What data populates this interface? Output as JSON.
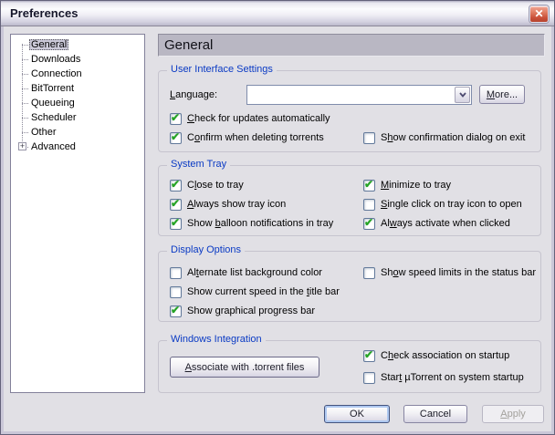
{
  "window": {
    "title": "Preferences"
  },
  "icons": {
    "close": "✕",
    "check": "✔",
    "plus": "+",
    "chevron": "chevron-down"
  },
  "colors": {
    "accent_blue": "#0a3ac4",
    "check_green": "#27a427",
    "close_red": "#c84e38",
    "titlebar_silver": "#d3d1e0"
  },
  "sidebar": {
    "items": [
      {
        "label": "General",
        "selected": true
      },
      {
        "label": "Downloads"
      },
      {
        "label": "Connection"
      },
      {
        "label": "BitTorrent"
      },
      {
        "label": "Queueing"
      },
      {
        "label": "Scheduler"
      },
      {
        "label": "Other"
      },
      {
        "label": "Advanced",
        "expandable": true
      }
    ]
  },
  "header": {
    "title": "General"
  },
  "ui_group": {
    "caption": "User Interface Settings",
    "language": {
      "label": "Language:",
      "mnemonic": 0,
      "value": ""
    },
    "more_button": {
      "label": "More...",
      "mnemonic": 0
    },
    "checks": [
      {
        "label": "Check for updates automatically",
        "mnemonic": 0,
        "checked": true
      },
      {
        "label": "Confirm when deleting torrents",
        "mnemonic": 1,
        "checked": true
      },
      {
        "label": "Show confirmation dialog on exit",
        "mnemonic": 1,
        "checked": false
      }
    ]
  },
  "tray_group": {
    "caption": "System Tray",
    "left": [
      {
        "label": "Close to tray",
        "mnemonic": 1,
        "checked": true
      },
      {
        "label": "Always show tray icon",
        "mnemonic": 0,
        "checked": true
      },
      {
        "label": "Show balloon notifications in tray",
        "mnemonic": 5,
        "checked": true
      }
    ],
    "right": [
      {
        "label": "Minimize to tray",
        "mnemonic": 0,
        "checked": true
      },
      {
        "label": "Single click on tray icon to open",
        "mnemonic": 0,
        "checked": false
      },
      {
        "label": "Always activate when clicked",
        "mnemonic": 2,
        "checked": true
      }
    ]
  },
  "display_group": {
    "caption": "Display Options",
    "left": [
      {
        "label": "Alternate list background color",
        "mnemonic": 2,
        "checked": false
      },
      {
        "label": "Show current speed in the title bar",
        "mnemonic": 26,
        "checked": false
      },
      {
        "label": "Show graphical progress bar",
        "mnemonic": 5,
        "checked": true
      }
    ],
    "right": [
      {
        "label": "Show speed limits in the status bar",
        "mnemonic": 2,
        "checked": false
      }
    ]
  },
  "windows_group": {
    "caption": "Windows Integration",
    "associate_button": {
      "label": "Associate with .torrent files",
      "mnemonic": 0
    },
    "checks": [
      {
        "label": "Check association on startup",
        "mnemonic": 1,
        "checked": true
      },
      {
        "label": "Start µTorrent on system startup",
        "mnemonic": 4,
        "checked": false
      }
    ]
  },
  "footer": {
    "ok": {
      "label": "OK"
    },
    "cancel": {
      "label": "Cancel"
    },
    "apply": {
      "label": "Apply",
      "mnemonic": 0,
      "disabled": true
    }
  }
}
